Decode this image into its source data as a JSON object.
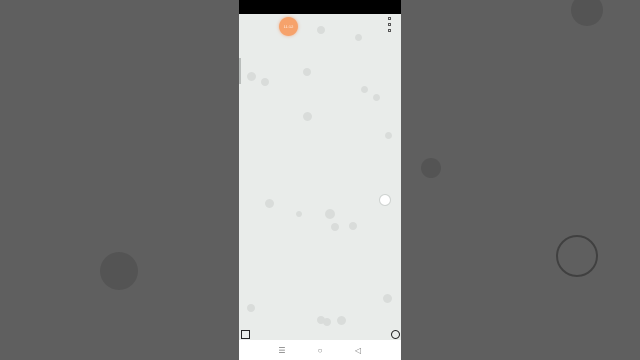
{
  "screen": {
    "fab_label": "11:12"
  },
  "nav": {
    "menu_glyph": "☰",
    "home_glyph": "○",
    "back_glyph": "◁"
  },
  "colors": {
    "accent": "#f6a26b",
    "screen_bg": "#e9ecea",
    "backdrop": "#5e5e5e"
  }
}
